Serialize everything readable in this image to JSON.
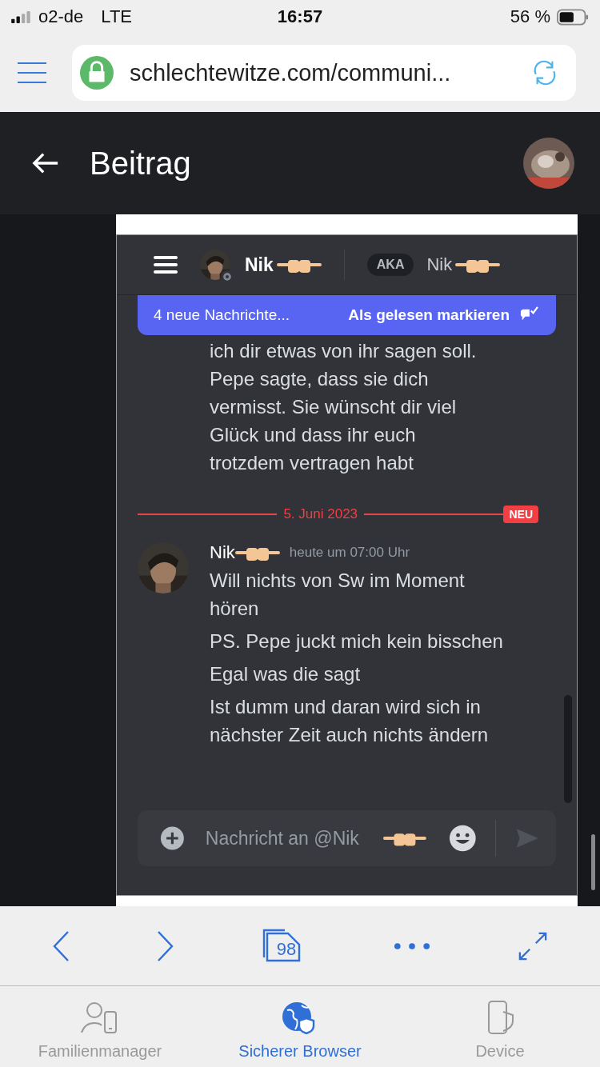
{
  "status_bar": {
    "carrier": "o2-de",
    "network": "LTE",
    "time": "16:57",
    "battery": "56 %"
  },
  "address_bar": {
    "url": "schlechtewitze.com/communi..."
  },
  "page_header": {
    "title": "Beitrag"
  },
  "embedded_screenshot": {
    "header": {
      "name": "Nik",
      "aka_badge": "AKA",
      "aka_name": "Nik"
    },
    "new_messages_banner": {
      "count_text": "4 neue Nachrichte...",
      "action": "Als gelesen markieren"
    },
    "earlier_message": {
      "text": "ich dir etwas von ihr sagen soll. Pepe sagte, dass sie dich vermisst. Sie wünscht dir viel Glück und dass ihr euch trotzdem vertragen habt"
    },
    "date_divider": {
      "date": "5. Juni 2023",
      "badge": "NEU"
    },
    "message": {
      "author": "Nik",
      "timestamp": "heute um 07:00 Uhr",
      "lines": [
        "Will nichts von Sw im Moment hören",
        "PS. Pepe juckt mich kein bisschen",
        "Egal was die sagt",
        "Ist dumm und daran wird sich in nächster Zeit auch nichts ändern"
      ]
    },
    "composer": {
      "placeholder": "Nachricht an @Nik"
    }
  },
  "toolbar": {
    "tab_count": "98"
  },
  "tabs": [
    {
      "label": "Familienmanager",
      "selected": false
    },
    {
      "label": "Sicherer Browser",
      "selected": true
    },
    {
      "label": "Device",
      "selected": false
    }
  ]
}
